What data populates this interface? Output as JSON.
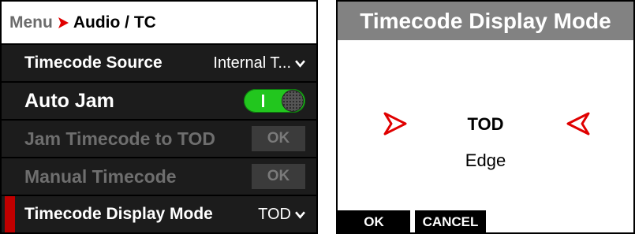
{
  "breadcrumb": {
    "menu": "Menu",
    "current": "Audio / TC"
  },
  "rows": {
    "timecode_source": {
      "label": "Timecode Source",
      "value": "Internal T..."
    },
    "auto_jam": {
      "label": "Auto Jam",
      "state": "on"
    },
    "jam_tod": {
      "label": "Jam Timecode to TOD",
      "button": "OK"
    },
    "manual_tc": {
      "label": "Manual Timecode",
      "button": "OK"
    },
    "display_mode": {
      "label": "Timecode Display Mode",
      "value": "TOD"
    }
  },
  "dialog": {
    "title": "Timecode Display Mode",
    "selected": "TOD",
    "next_option": "Edge",
    "ok_label": "OK",
    "cancel_label": "CANCEL"
  },
  "colors": {
    "accent_red": "#e00000",
    "toggle_green": "#22c61e",
    "title_gray": "#828282"
  },
  "icons": [
    "breadcrumb-arrow-icon",
    "chevron-down-icon",
    "left-arrow-icon",
    "right-arrow-icon"
  ]
}
